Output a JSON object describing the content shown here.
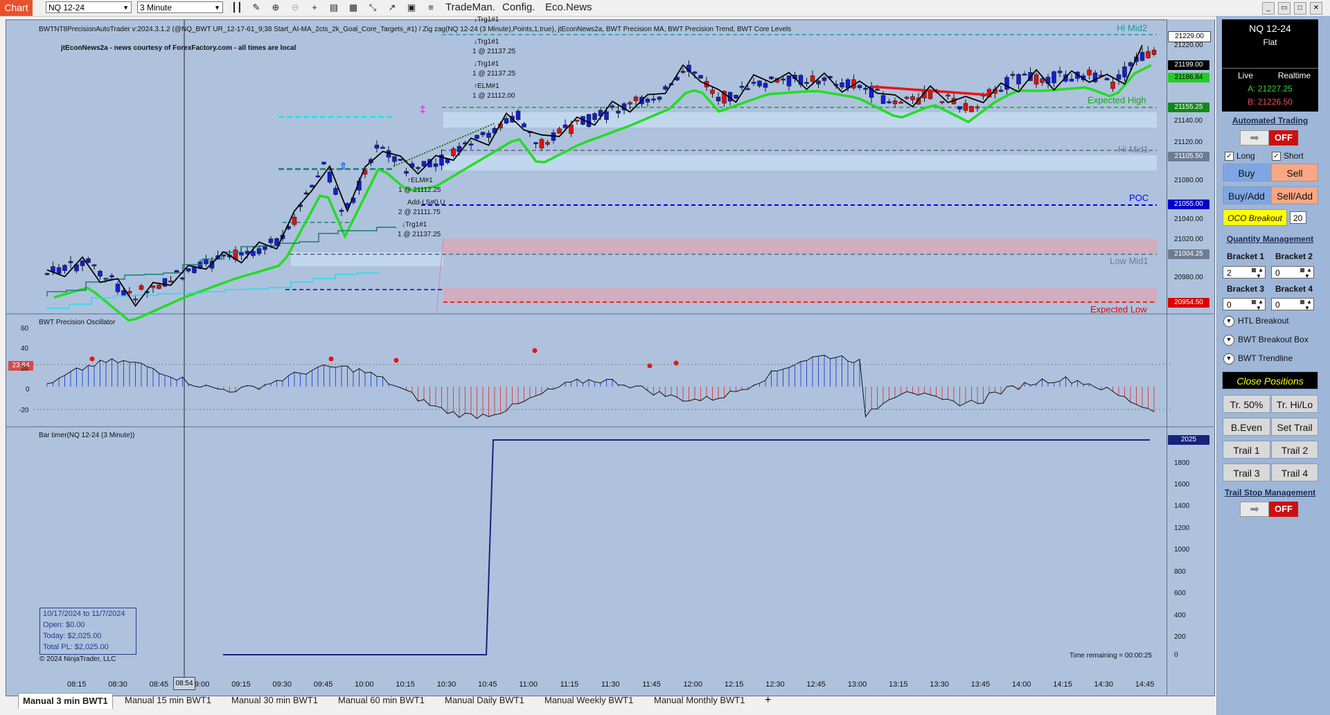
{
  "toolbar": {
    "chart_tab": "Chart",
    "instrument": "NQ 12-24",
    "interval": "3 Minute",
    "menus": [
      "TradeMan.",
      "Config.",
      "Eco.News"
    ],
    "icons": [
      "bar-style-icon",
      "draw-icon",
      "zoom-in-icon",
      "zoom-out-icon",
      "crosshair-icon",
      "template-icon",
      "properties-icon",
      "strategies-icon",
      "indicators-icon",
      "data-box-icon",
      "menu-icon"
    ]
  },
  "window_buttons": {
    "minimize": "_",
    "restore": "▭",
    "maximize": "□",
    "close": "✕"
  },
  "chart": {
    "info_line": "BWTNT8PrecisionAutoTrader v:2024.3.1.2 (@NQ_BWT UR_12-17-61_9;38 Start_AI-MA_2cts_2k_Goal_Core_Targets_#1) / Zig zag(NQ 12-24 (3 Minute),Points,1,true), jtEconNews2a, BWT Precision MA, BWT Precision Trend, BWT Core Levels",
    "news_credit": "jtEconNews2a - news courtesy of ForexFactory.com - all times are local",
    "levels": [
      {
        "label": "Hi Mid2",
        "price": 21229.0,
        "color": "#1a9a9a"
      },
      {
        "label": "Expected High",
        "price": 21155.25,
        "color": "#1aa51a"
      },
      {
        "label": "Hi Mid1",
        "price": 21105.5,
        "color": "#6e7c92"
      },
      {
        "label": "POC",
        "price": 21055.0,
        "color": "#0000ee"
      },
      {
        "label": "Low Mid1",
        "price": 21004.25,
        "color": "#6e7c92"
      },
      {
        "label": "Expected Low",
        "price": 20954.5,
        "color": "#ee0000"
      }
    ],
    "price_tags": [
      {
        "value": "21229.00",
        "bg": "#ffffff",
        "fg": "#000000"
      },
      {
        "value": "21199.00",
        "bg": "#000000",
        "fg": "#ffffff"
      },
      {
        "value": "21186.84",
        "bg": "#22cc22",
        "fg": "#000000"
      },
      {
        "value": "21155.25",
        "bg": "#11881b",
        "fg": "#ffffff"
      },
      {
        "value": "21105.50",
        "bg": "#6e7c92",
        "fg": "#ffffff"
      },
      {
        "value": "21055.00",
        "bg": "#0000cc",
        "fg": "#ffffff"
      },
      {
        "value": "21004.25",
        "bg": "#6e7c92",
        "fg": "#ffffff"
      },
      {
        "value": "20954.50",
        "bg": "#dd0000",
        "fg": "#ffffff"
      }
    ],
    "price_ticks": [
      "21220.00",
      "21140.00",
      "21120.00",
      "21080.00",
      "21040.00",
      "21020.00",
      "20980.00"
    ],
    "annotations": [
      {
        "text": "↓Trg1#1"
      },
      {
        "text": "1 @ 21137.25"
      },
      {
        "text": "↓Trg1#1"
      },
      {
        "text": "1 @ 21137.25"
      },
      {
        "text": "↓Trg1#1"
      },
      {
        "text": "1 @ 21137.25"
      },
      {
        "text": "↑ELM#1"
      },
      {
        "text": "1 @ 21112.00"
      },
      {
        "text": "↑ELM#1"
      },
      {
        "text": "1 @ 21112.25"
      },
      {
        "text": "Add-LS#0.U"
      },
      {
        "text": "2 @ 21111.75"
      }
    ],
    "time_labels": [
      "08:15",
      "08:30",
      "08:45",
      "09:00",
      "09:15",
      "09:30",
      "09:45",
      "10:00",
      "10:15",
      "10:30",
      "10:45",
      "11:00",
      "11:15",
      "11:30",
      "11:45",
      "12:00",
      "12:15",
      "12:30",
      "12:45",
      "13:00",
      "13:15",
      "13:30",
      "13:45",
      "14:00",
      "14:15",
      "14:30",
      "14:45"
    ],
    "cursor_time": "08:54"
  },
  "oscillator": {
    "title": "BWT Precision Oscillator",
    "current_tag": "23.64",
    "ticks": [
      "60",
      "40",
      "20",
      "0",
      "-20"
    ]
  },
  "bar_timer": {
    "title": "Bar timer(NQ 12-24 (3 Minute))",
    "current_tag": "2025",
    "ticks": [
      "1800",
      "1600",
      "1400",
      "1200",
      "1000",
      "800",
      "600",
      "400",
      "200",
      "0"
    ],
    "time_remaining": "Time remaining = 00:00:25"
  },
  "pl_box": {
    "range": "10/17/2024 to 11/7/2024",
    "open": "Open: $0.00",
    "today": "Today: $2,025.00",
    "total": "Total PL: $2,025.00"
  },
  "copyright": "© 2024 NinjaTrader, LLC",
  "tabs": [
    "Manual 3 min BWT1",
    "Manual 15 min BWT1",
    "Manual 30 min BWT1",
    "Manual 60 min BWT1",
    "Manual Daily BWT1",
    "Manual Weekly BWT1",
    "Manual Monthly BWT1"
  ],
  "add_tab": "+",
  "panel": {
    "symbol": "NQ 12-24",
    "position": "Flat",
    "live": "Live",
    "realtime": "Realtime",
    "ask": "A: 21227.25",
    "bid": "B: 21226.50",
    "automated_trading": "Automated Trading",
    "auto_state": "OFF",
    "long_label": "Long",
    "short_label": "Short",
    "buy": "Buy",
    "sell": "Sell",
    "buy_add": "Buy/Add",
    "sell_add": "Sell/Add",
    "oco_breakout": "OCO Breakout",
    "oco_value": "20",
    "quantity_management": "Quantity Management",
    "bracket1": "Bracket 1",
    "bracket2": "Bracket 2",
    "bracket3": "Bracket 3",
    "bracket4": "Bracket 4",
    "bracket1_qty": "2",
    "bracket2_qty": "0",
    "bracket3_qty": "0",
    "bracket4_qty": "0",
    "htl_breakout": "HTL Breakout",
    "breakout_box": "BWT Breakout Box",
    "trendline": "BWT Trendline",
    "close_positions": "Close Positions",
    "tr50": "Tr. 50%",
    "tr_hilo": "Tr. Hi/Lo",
    "b_even": "B.Even",
    "set_trail": "Set Trail",
    "trail1": "Trail 1",
    "trail2": "Trail 2",
    "trail3": "Trail 3",
    "trail4": "Trail 4",
    "trail_stop_management": "Trail Stop Management",
    "trail_state": "OFF"
  }
}
